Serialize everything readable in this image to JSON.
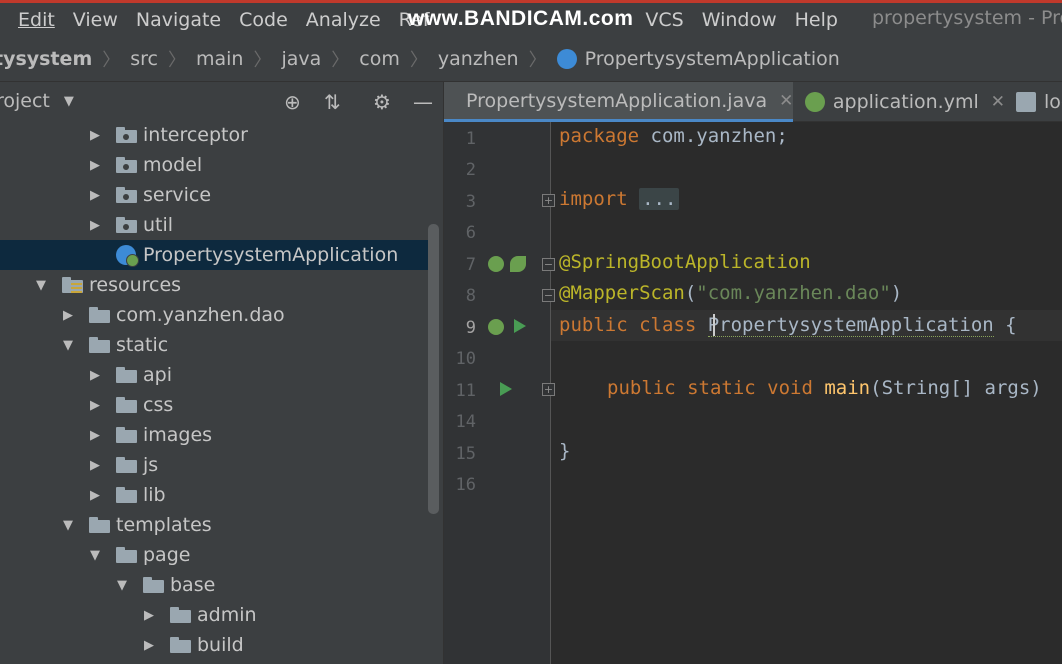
{
  "menu": [
    "Edit",
    "View",
    "Navigate",
    "Code",
    "Analyze",
    "Ref",
    "VCS",
    "Window",
    "Help"
  ],
  "watermark": "www.BANDICAM.com",
  "window_title": "propertysystem - Prop",
  "breadcrumb": [
    "tysystem",
    "src",
    "main",
    "java",
    "com",
    "yanzhen",
    "PropertysystemApplication"
  ],
  "project_panel": {
    "title": "roject"
  },
  "tree": [
    {
      "label": "interceptor",
      "type": "package",
      "arrow": "right"
    },
    {
      "label": "model",
      "type": "package",
      "arrow": "right"
    },
    {
      "label": "service",
      "type": "package",
      "arrow": "right"
    },
    {
      "label": "util",
      "type": "package",
      "arrow": "right"
    },
    {
      "label": "PropertysystemApplication",
      "type": "spring-class",
      "arrow": "",
      "selected": true
    },
    {
      "label": "resources",
      "type": "resources",
      "arrow": "down"
    },
    {
      "label": "com.yanzhen.dao",
      "type": "folder",
      "arrow": "right"
    },
    {
      "label": "static",
      "type": "folder",
      "arrow": "down"
    },
    {
      "label": "api",
      "type": "folder",
      "arrow": "right"
    },
    {
      "label": "css",
      "type": "folder",
      "arrow": "right"
    },
    {
      "label": "images",
      "type": "folder",
      "arrow": "right"
    },
    {
      "label": "js",
      "type": "folder",
      "arrow": "right"
    },
    {
      "label": "lib",
      "type": "folder",
      "arrow": "right"
    },
    {
      "label": "templates",
      "type": "folder",
      "arrow": "down"
    },
    {
      "label": "page",
      "type": "folder",
      "arrow": "down"
    },
    {
      "label": "base",
      "type": "folder",
      "arrow": "down"
    },
    {
      "label": "admin",
      "type": "folder",
      "arrow": "right"
    },
    {
      "label": "build",
      "type": "folder",
      "arrow": "right"
    }
  ],
  "tabs": [
    {
      "label": "PropertysystemApplication.java",
      "active": true
    },
    {
      "label": "application.yml",
      "active": false
    },
    {
      "label": "log",
      "active": false
    }
  ],
  "line_numbers": [
    "1",
    "2",
    "3",
    "6",
    "7",
    "8",
    "9",
    "10",
    "11",
    "14",
    "15",
    "16"
  ],
  "current_line": "9",
  "code": {
    "l1_kw": "package",
    "l1_rest": " com.yanzhen;",
    "l3_kw": "import",
    "l3_fold": "...",
    "l7": "@SpringBootApplication",
    "l8_ann": "@MapperScan",
    "l8_open": "(",
    "l8_str": "\"com.yanzhen.dao\"",
    "l8_close": ")",
    "l9_kw": "public class",
    "l9_name": "PropertysystemApplication",
    "l9_brace": " {",
    "l11_kw": "public static void",
    "l11_fn": "main",
    "l11_args": "(String[] args)",
    "l15": "}"
  }
}
